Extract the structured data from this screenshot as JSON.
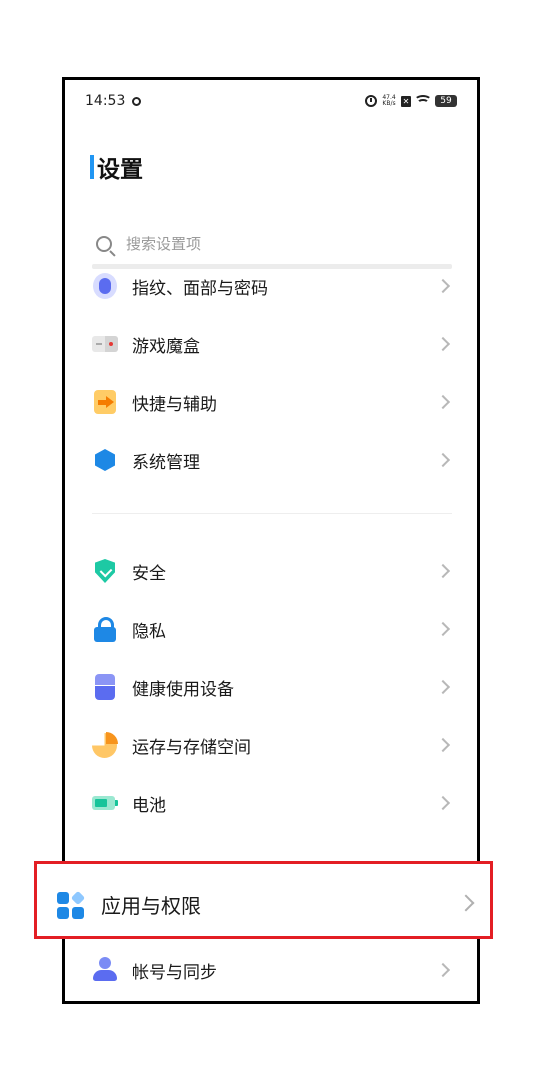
{
  "status_bar": {
    "time": "14:53",
    "network_speed_value": "47.4",
    "network_speed_unit": "KB/s",
    "battery": "59"
  },
  "header": {
    "title": "设置"
  },
  "search": {
    "placeholder": "搜索设置项"
  },
  "settings": {
    "group1": [
      {
        "label": "指纹、面部与密码",
        "icon": "fingerprint-icon"
      },
      {
        "label": "游戏魔盒",
        "icon": "game-box-icon"
      },
      {
        "label": "快捷与辅助",
        "icon": "shortcut-icon"
      },
      {
        "label": "系统管理",
        "icon": "system-management-icon"
      }
    ],
    "group2": [
      {
        "label": "安全",
        "icon": "security-shield-icon"
      },
      {
        "label": "隐私",
        "icon": "privacy-lock-icon"
      },
      {
        "label": "健康使用设备",
        "icon": "healthy-usage-icon"
      },
      {
        "label": "运存与存储空间",
        "icon": "storage-pie-icon"
      },
      {
        "label": "电池",
        "icon": "battery-icon"
      }
    ],
    "highlighted": {
      "label": "应用与权限",
      "icon": "apps-permissions-icon"
    },
    "bottom": {
      "label": "帐号与同步",
      "icon": "account-icon"
    }
  },
  "colors": {
    "accent": "#2196f3",
    "highlight_border": "#e31e24"
  }
}
